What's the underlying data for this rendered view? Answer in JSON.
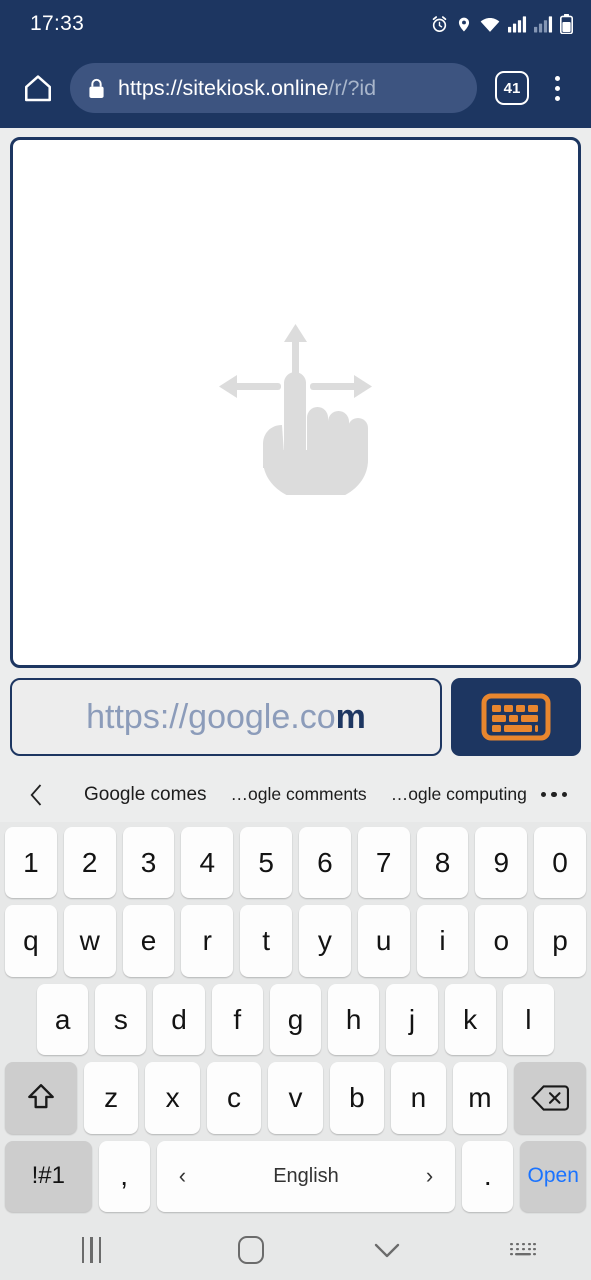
{
  "statusbar": {
    "time": "17:33",
    "icons": [
      "alarm-icon",
      "location-icon",
      "wifi-icon",
      "signal-icon",
      "signal-secondary-icon",
      "battery-icon"
    ]
  },
  "browser": {
    "home_icon": "home-icon",
    "lock_icon": "lock-icon",
    "url_secure": "https://sitekiosk.online",
    "url_path": "/r/?id",
    "tab_count": "41",
    "menu_icon": "kebab-menu-icon",
    "accent": "#1d3661"
  },
  "page": {
    "gesture_hint_icon": "swipe-gesture-hand-icon",
    "url_input": {
      "suggestion_prefix": "https://google.co",
      "typed_suffix": "m",
      "full_value": "https://google.com",
      "placeholder": "https://"
    },
    "keyboard_toggle_icon": "keyboard-icon",
    "keyboard_toggle_color": "#e8862e"
  },
  "ime": {
    "back_icon": "chevron-left-icon",
    "suggestions": [
      "Google comes",
      "…ogle comments",
      "…ogle computing"
    ],
    "more_icon": "more-dots-icon",
    "rows": {
      "numbers": [
        "1",
        "2",
        "3",
        "4",
        "5",
        "6",
        "7",
        "8",
        "9",
        "0"
      ],
      "top": [
        "q",
        "w",
        "e",
        "r",
        "t",
        "y",
        "u",
        "i",
        "o",
        "p"
      ],
      "home": [
        "a",
        "s",
        "d",
        "f",
        "g",
        "h",
        "j",
        "k",
        "l"
      ],
      "bottom": [
        "z",
        "x",
        "c",
        "v",
        "b",
        "n",
        "m"
      ]
    },
    "shift_icon": "shift-arrow-icon",
    "backspace_icon": "backspace-icon",
    "symbols_label": "!#1",
    "comma_label": ",",
    "space_label": "English",
    "space_prev_icon": "chevron-left-icon",
    "space_next_icon": "chevron-right-icon",
    "period_label": ".",
    "open_label": "Open",
    "open_color": "#1a73ff"
  },
  "navbar": {
    "recents_icon": "recents-icon",
    "home_icon": "home-square-icon",
    "hide_keyboard_icon": "chevron-down-icon",
    "switch_keyboard_icon": "keyboard-switch-icon"
  }
}
